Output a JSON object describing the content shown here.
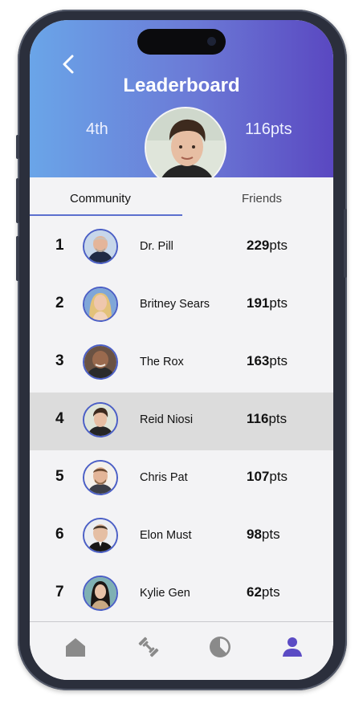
{
  "header": {
    "title": "Leaderboard",
    "rank": "4th",
    "points": "116pts"
  },
  "tabs": [
    {
      "label": "Community",
      "active": true
    },
    {
      "label": "Friends",
      "active": false
    }
  ],
  "leaderboard": [
    {
      "rank": "1",
      "name": "Dr. Pill",
      "score": "229",
      "unit": "pts"
    },
    {
      "rank": "2",
      "name": "Britney Sears",
      "score": "191",
      "unit": "pts"
    },
    {
      "rank": "3",
      "name": "The Rox",
      "score": "163",
      "unit": "pts"
    },
    {
      "rank": "4",
      "name": "Reid Niosi",
      "score": "116",
      "unit": "pts",
      "highlighted": true
    },
    {
      "rank": "5",
      "name": "Chris Pat",
      "score": "107",
      "unit": "pts"
    },
    {
      "rank": "6",
      "name": "Elon Must",
      "score": "98",
      "unit": "pts"
    },
    {
      "rank": "7",
      "name": "Kylie Gen",
      "score": "62",
      "unit": "pts"
    }
  ],
  "bottom_nav": [
    {
      "icon": "home-icon",
      "active": false
    },
    {
      "icon": "dumbbell-icon",
      "active": false
    },
    {
      "icon": "pie-chart-icon",
      "active": false
    },
    {
      "icon": "profile-icon",
      "active": true
    }
  ],
  "colors": {
    "header_start": "#6aa5e8",
    "header_end": "#5a48c1",
    "accent": "#5b4bc4",
    "highlight_row": "#dcdcdc",
    "nav_inactive": "#8a8a8a"
  }
}
